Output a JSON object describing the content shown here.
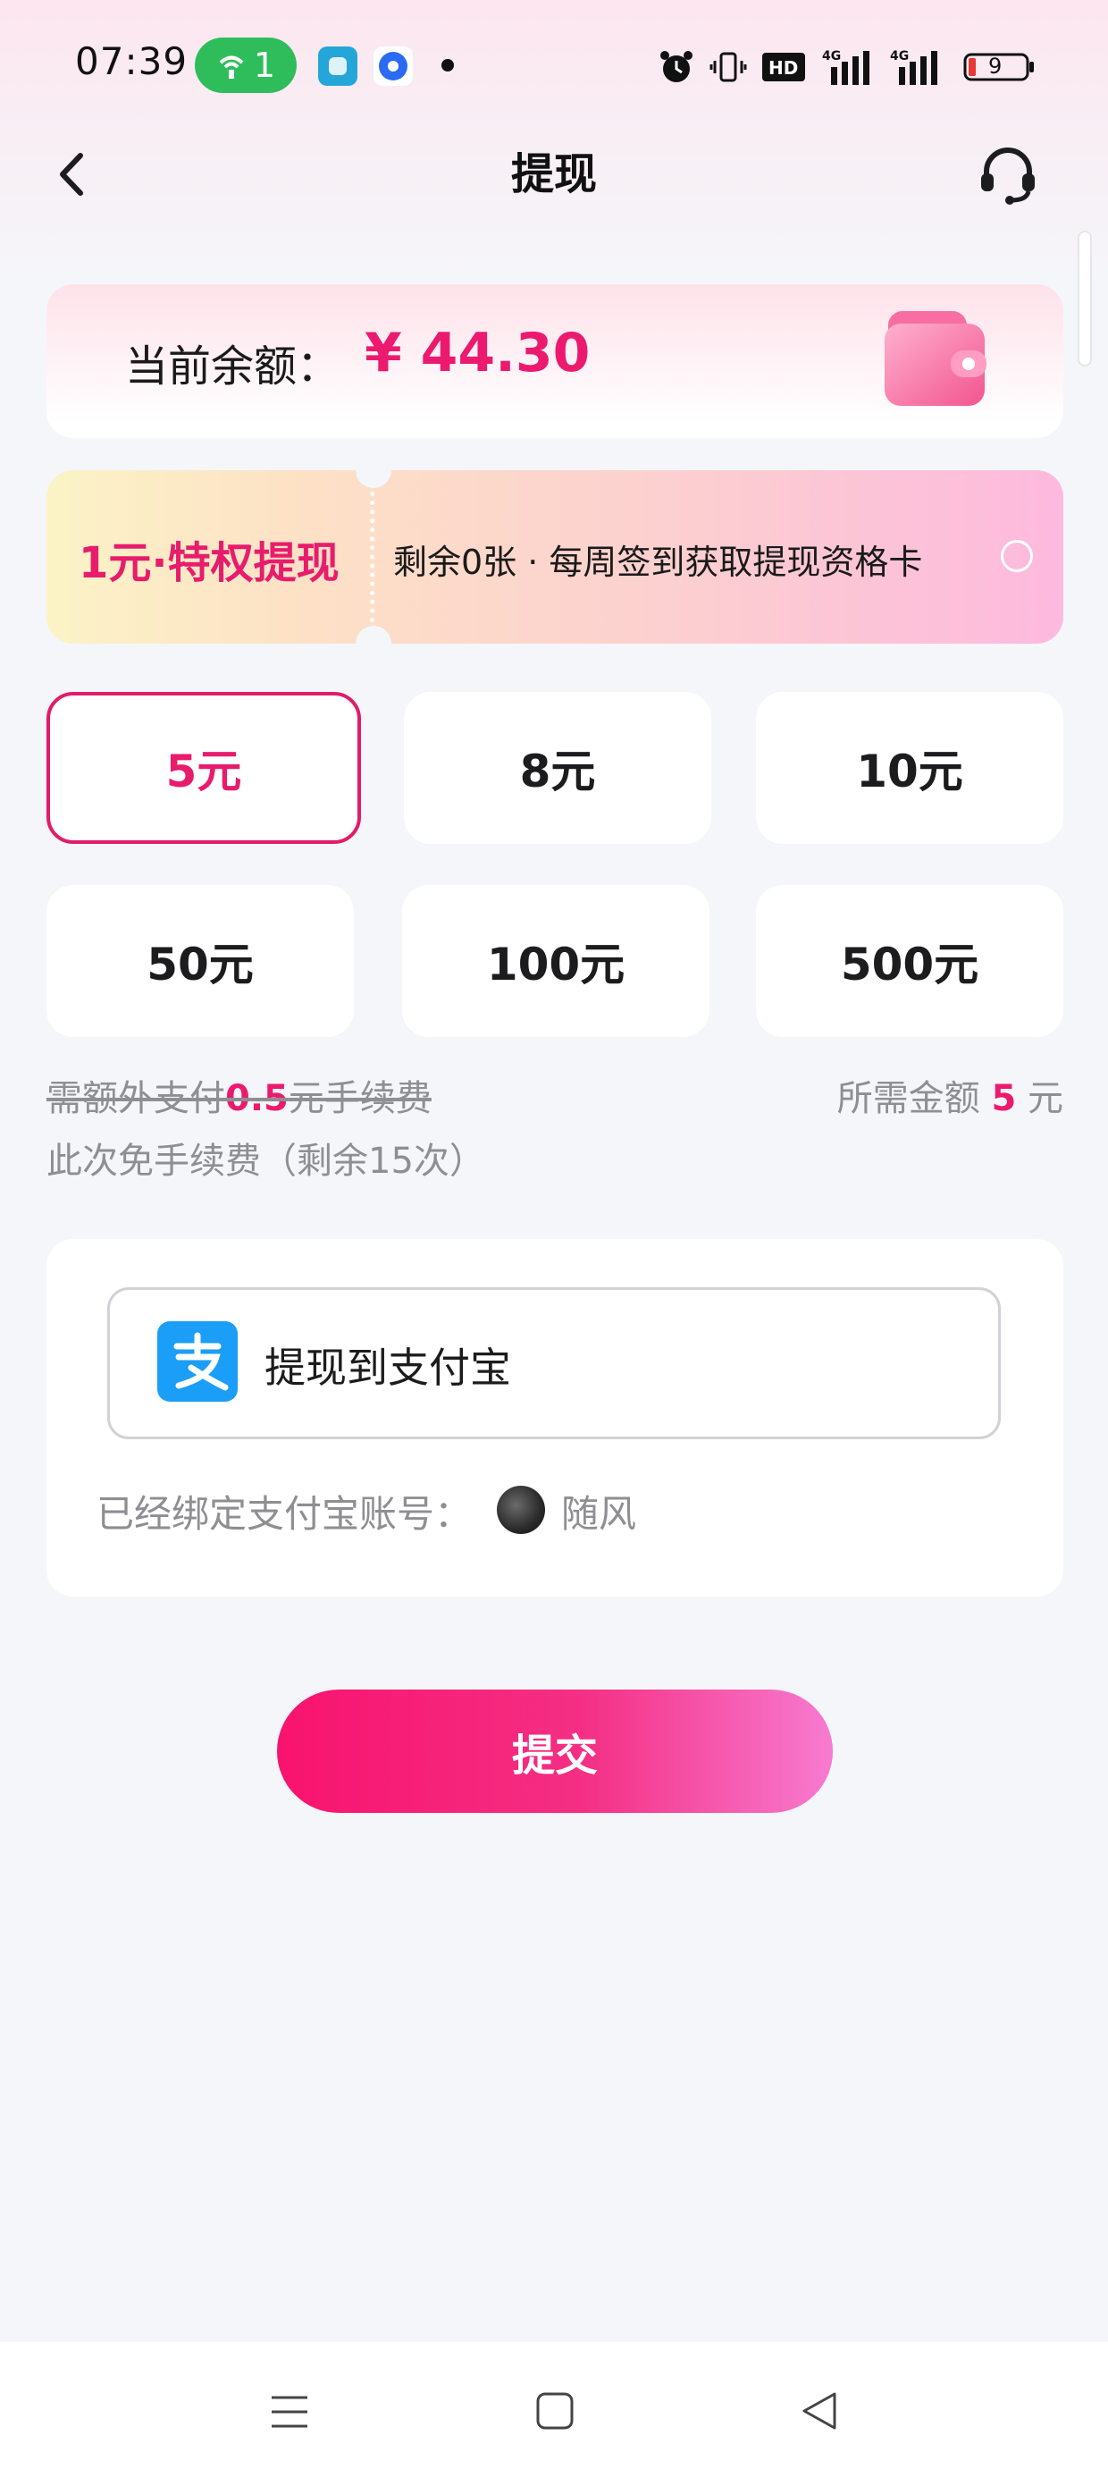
{
  "status_bar": {
    "time": "07:39",
    "hotspot_count": "1",
    "battery_level": "9",
    "network_1": "4G",
    "network_2": "4G",
    "hd_label": "HD"
  },
  "header": {
    "title": "提现"
  },
  "balance": {
    "label": "当前余额：",
    "currency": "¥",
    "amount": "44.30"
  },
  "coupon": {
    "title": "1元·特权提现",
    "description": "剩余0张 · 每周签到获取提现资格卡"
  },
  "amounts": {
    "items": [
      "5元",
      "8元",
      "10元",
      "50元",
      "100元",
      "500元"
    ],
    "selected": "5元"
  },
  "fee": {
    "extra_prefix": "需额外支付",
    "extra_value": "0.5",
    "extra_suffix": "元手续费",
    "free_note": "此次免手续费（剩余15次）",
    "required_label": "所需金额",
    "required_value": "5",
    "required_unit": "元"
  },
  "payment": {
    "method_label": "提现到支付宝",
    "bound_label": "已经绑定支付宝账号：",
    "account_name": "随风"
  },
  "submit_label": "提交",
  "colors": {
    "accent": "#ec1a6f",
    "alipay_blue": "#1a9ef7",
    "hotspot_green": "#2fbd5b"
  }
}
